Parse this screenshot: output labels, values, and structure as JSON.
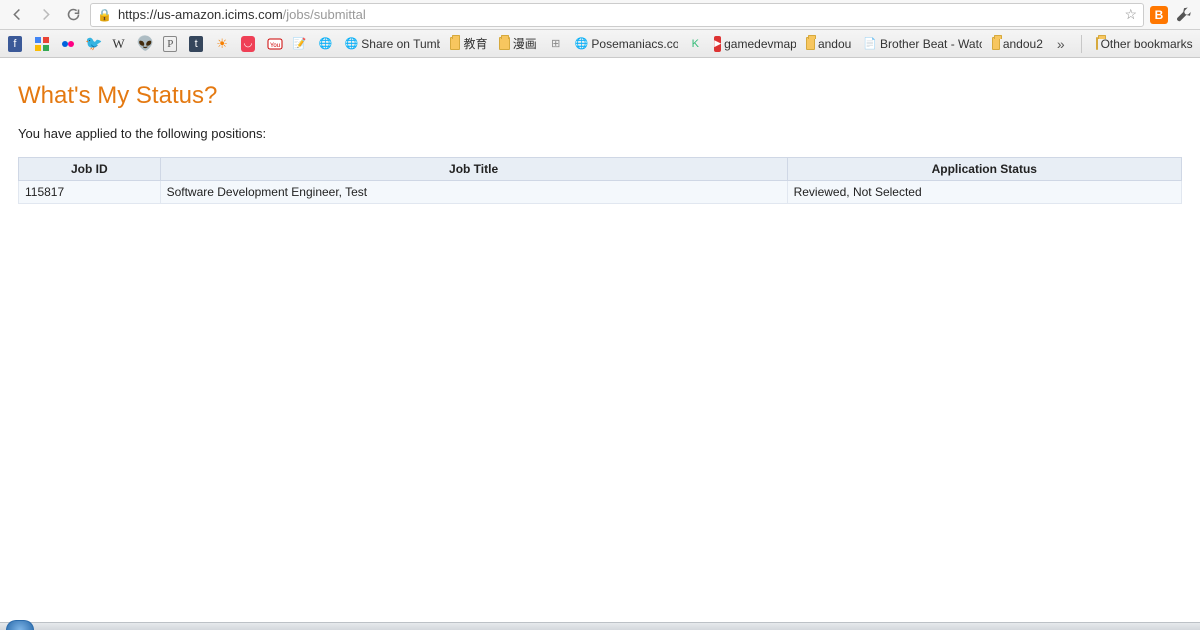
{
  "browser": {
    "url_host": "https://us-amazon.icims.com",
    "url_path": "/jobs/submittal"
  },
  "bookmarks": {
    "items": [
      {
        "icon": "fb",
        "label": ""
      },
      {
        "icon": "goog",
        "label": ""
      },
      {
        "icon": "flickr",
        "label": ""
      },
      {
        "icon": "tw",
        "label": ""
      },
      {
        "icon": "w",
        "label": ""
      },
      {
        "icon": "reddit",
        "label": ""
      },
      {
        "icon": "p",
        "label": ""
      },
      {
        "icon": "tumblr",
        "label": ""
      },
      {
        "icon": "grooveshark",
        "label": ""
      },
      {
        "icon": "pocket",
        "label": ""
      },
      {
        "icon": "yt",
        "label": ""
      },
      {
        "icon": "note",
        "label": ""
      },
      {
        "icon": "globe",
        "label": ""
      },
      {
        "icon": "tumblr-share",
        "label": "Share on Tumblr"
      },
      {
        "icon": "folder",
        "label": "教育"
      },
      {
        "icon": "folder",
        "label": "漫画"
      },
      {
        "icon": "grid",
        "label": ""
      },
      {
        "icon": "pose",
        "label": "Posemaniacs.com"
      },
      {
        "icon": "k",
        "label": ""
      },
      {
        "icon": "gd",
        "label": "gamedevmap"
      },
      {
        "icon": "folder",
        "label": "andou"
      },
      {
        "icon": "doc",
        "label": "Brother Beat - Watc..."
      },
      {
        "icon": "folder",
        "label": "andou2"
      }
    ],
    "other": "Other bookmarks"
  },
  "page": {
    "heading": "What's My Status?",
    "intro": "You have applied to the following positions:",
    "columns": {
      "job_id": "Job ID",
      "job_title": "Job Title",
      "status": "Application Status"
    },
    "rows": [
      {
        "job_id": "115817",
        "job_title": "Software Development Engineer, Test",
        "status": "Reviewed, Not Selected"
      }
    ]
  }
}
